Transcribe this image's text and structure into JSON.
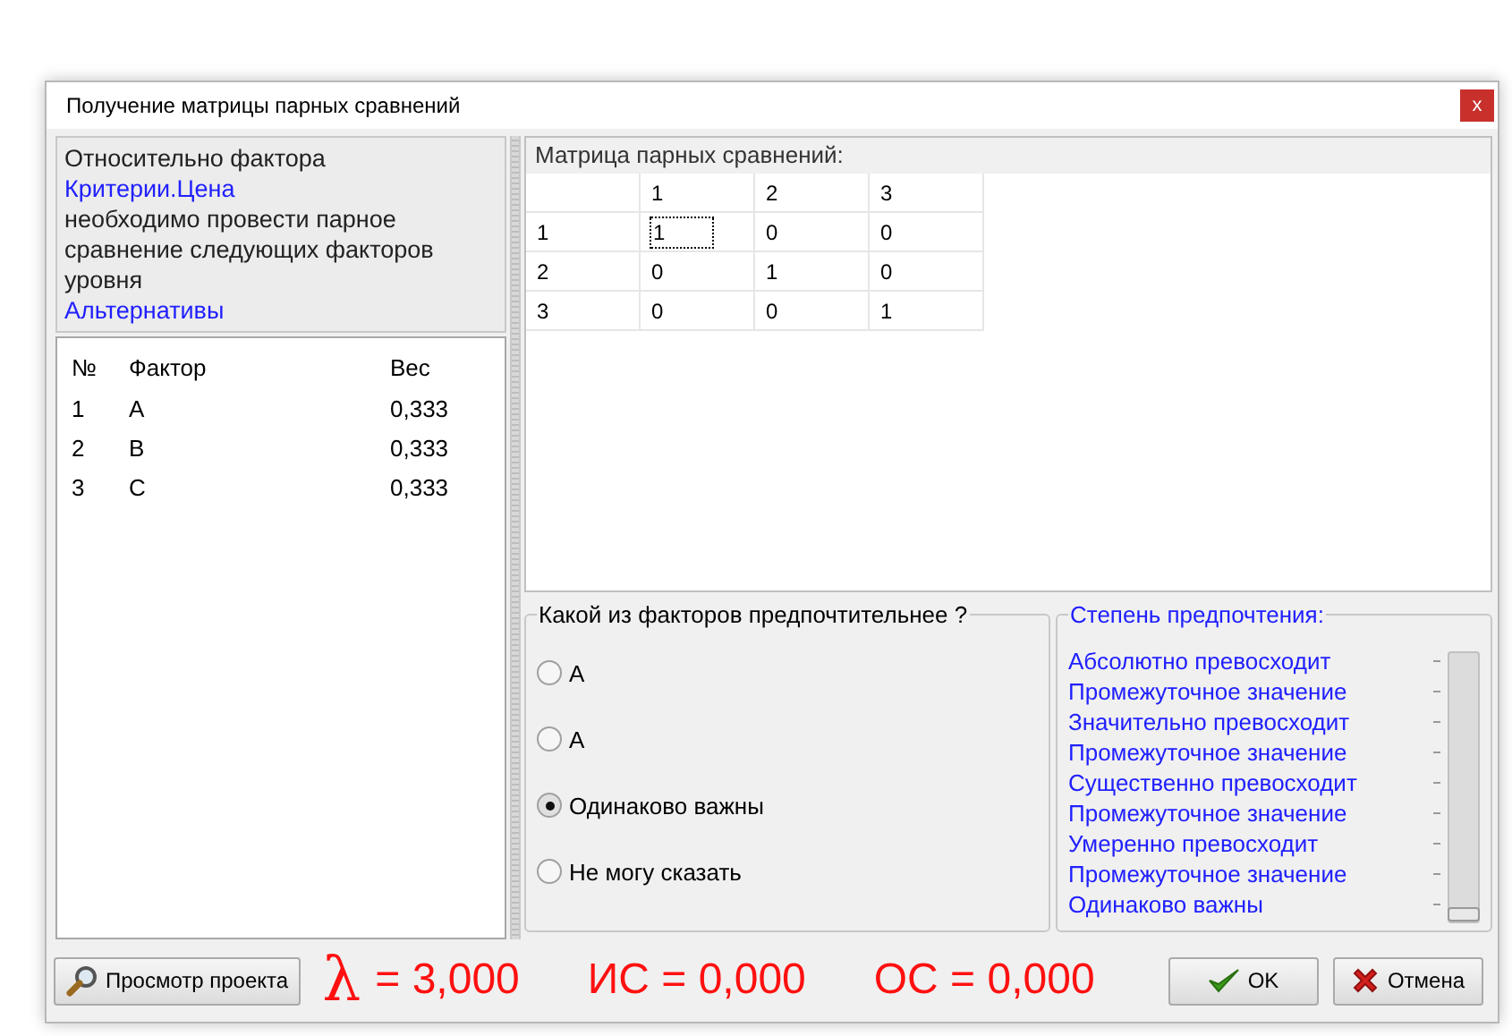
{
  "window": {
    "title": "Получение матрицы парных сравнений",
    "close": "x"
  },
  "info": {
    "lines": [
      {
        "text": "Относительно фактора",
        "kind": "plain"
      },
      {
        "text": "Критерии.Цена",
        "kind": "link"
      },
      {
        "text": "необходимо провести парное сравнение следующих факторов уровня",
        "kind": "plain"
      },
      {
        "text": "Альтернативы",
        "kind": "link"
      }
    ]
  },
  "factors": {
    "columns": [
      "№",
      "Фактор",
      "Вес"
    ],
    "rows": [
      [
        "1",
        "A",
        "0,333"
      ],
      [
        "2",
        "B",
        "0,333"
      ],
      [
        "3",
        "C",
        "0,333"
      ]
    ]
  },
  "matrix": {
    "label": "Матрица парных сравнений:",
    "columns": [
      "1",
      "2",
      "3"
    ],
    "rows": [
      {
        "label": "1",
        "cells": [
          {
            "value": "1",
            "focused": true
          },
          {
            "value": "0",
            "focused": false
          },
          {
            "value": "0",
            "focused": false
          }
        ]
      },
      {
        "label": "2",
        "cells": [
          {
            "value": "0",
            "focused": false
          },
          {
            "value": "1",
            "focused": false
          },
          {
            "value": "0",
            "focused": false
          }
        ]
      },
      {
        "label": "3",
        "cells": [
          {
            "value": "0",
            "focused": false
          },
          {
            "value": "0",
            "focused": false
          },
          {
            "value": "1",
            "focused": false
          }
        ]
      }
    ]
  },
  "preference": {
    "title": "Какой из факторов предпочтительнее ?",
    "options": [
      {
        "label": "A",
        "selected": false
      },
      {
        "label": "A",
        "selected": false
      },
      {
        "label": "Одинаково важны",
        "selected": true
      },
      {
        "label": "Не могу сказать",
        "selected": false
      }
    ]
  },
  "degree": {
    "title": "Степень предпочтения:",
    "level": 0,
    "labels": [
      "Абсолютно превосходит",
      "Промежуточное значение",
      "Значительно превосходит",
      "Промежуточное значение",
      "Существенно превосходит",
      "Промежуточное значение",
      "Умеренно превосходит",
      "Промежуточное значение",
      "Одинаково важны"
    ]
  },
  "footer": {
    "project_button": "Просмотр проекта",
    "lambda_symbol": "λ",
    "lambda_value": "= 3,000",
    "ci": "ИС = 0,000",
    "cr": "ОС = 0,000",
    "ok_button": "OK",
    "cancel_button": "Отмена"
  }
}
